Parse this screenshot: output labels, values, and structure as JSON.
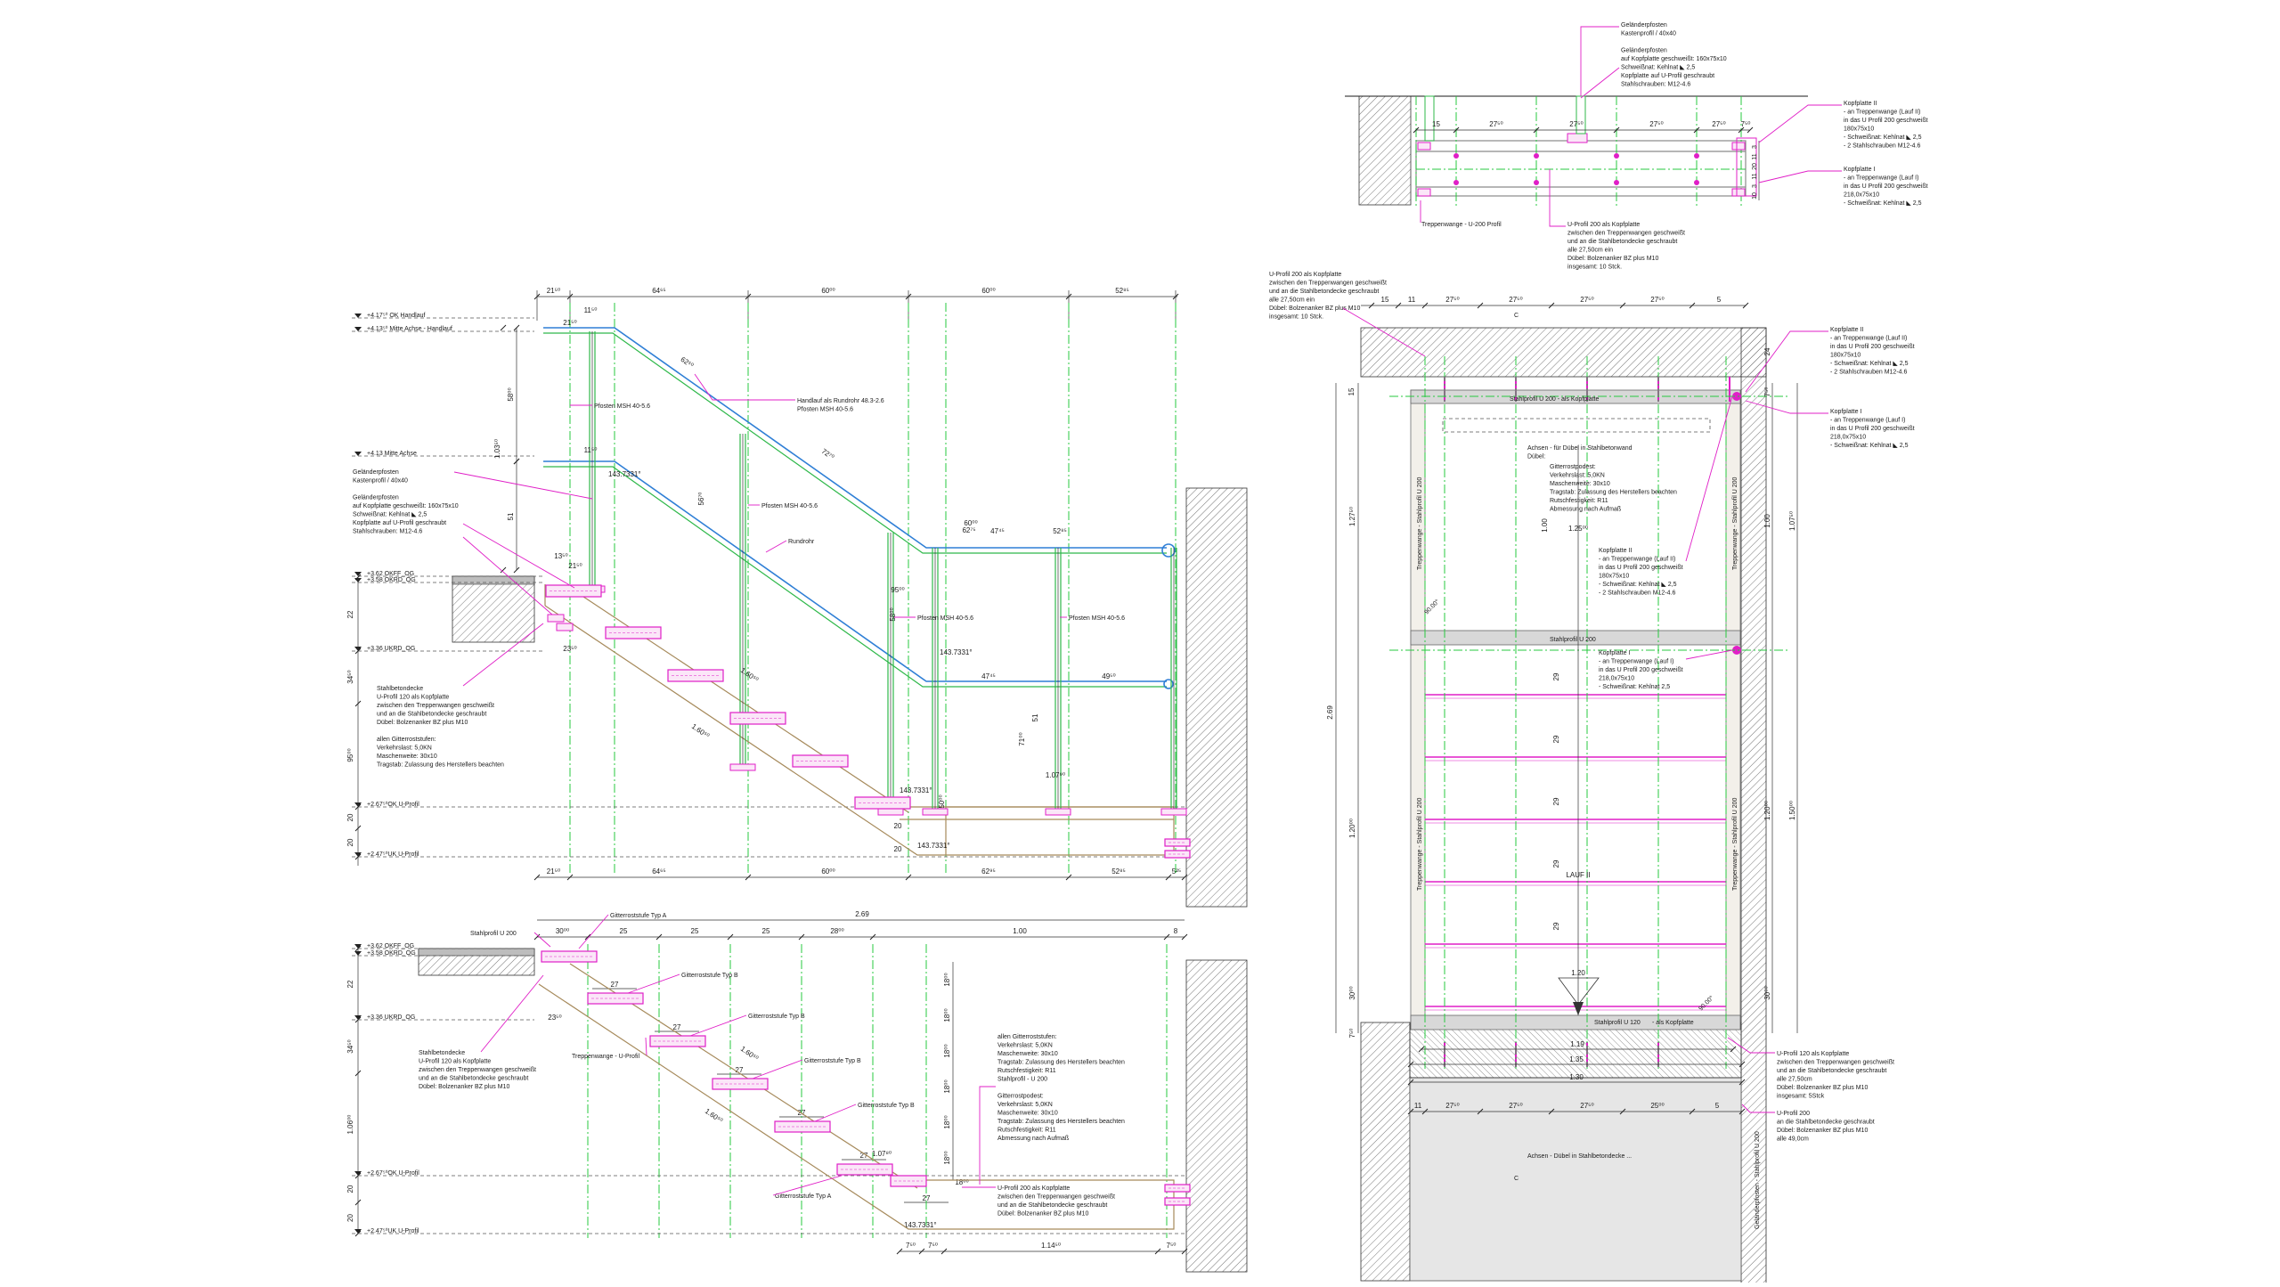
{
  "side_view": {
    "top_dims": [
      "21⁵⁰",
      "64⁶⁵",
      "60⁰⁰",
      "60⁰⁰",
      "52⁸⁵"
    ],
    "bottom_dims": [
      "21⁵⁰",
      "64⁶⁵",
      "60⁰⁰",
      "62⁹⁵",
      "52⁸⁵",
      "5²⁵"
    ],
    "level_labels": [
      "+4.17⁵⁰ OK Handlauf",
      "+4.13⁵⁰ Mitte Achse - Handlauf",
      "+4.13 Mitte Achse",
      "+3.62 OKFF_OG",
      "+3.58 OKRD_OG",
      "+3.36 UKRD_OG",
      "+2.67⁵⁰OK U-Profil",
      "+2.47⁵⁰UK U-Profil"
    ],
    "left_dims": [
      "22",
      "34⁵⁰",
      "95⁰⁰",
      "20",
      "20"
    ],
    "vert_dims": [
      "58⁰⁰",
      "1.03⁵⁰",
      "51"
    ],
    "inline_dims": [
      "11⁵⁰",
      "21⁵⁰",
      "11⁵⁰",
      "13⁵⁰",
      "21⁵⁰",
      "23⁵⁰",
      "62⁵⁰",
      "72⁷⁰",
      "60⁰⁰",
      "62⁷⁵",
      "47⁴⁵",
      "52⁸⁵",
      "95⁰⁰",
      "71⁰⁰",
      "56⁷⁰",
      "1.60⁵⁰",
      "1.60⁵⁰",
      "47⁴⁵",
      "49⁵⁰",
      "1.07⁹⁰",
      "50⁰⁰",
      "58⁰⁰",
      "51",
      "20",
      "20"
    ],
    "angles": [
      "143.7331°",
      "143.7331°",
      "143.7331°",
      "143.7331°"
    ],
    "callouts": {
      "handlauf": [
        "Handlauf als Rundrohr 48.3-2.6",
        "Pfosten MSH 40-5.6"
      ],
      "pfosten1": "Pfosten MSH 40-5.6",
      "pfosten2": "Pfosten MSH 40-5.6",
      "pfosten3": "Pfosten MSH 40-5.6",
      "pfosten4": "Pfosten MSH 40-5.6",
      "rundrohr": "Rundrohr",
      "gelaender": [
        "Geländerpfosten",
        "Kastenprofil / 40x40",
        "",
        "Geländerpfosten",
        "auf Kopfplatte geschweißt: 160x75x10",
        "Schweißnat: Kehlnat ◣ 2,5",
        "Kopfplatte auf U-Profil geschraubt",
        "Stahlschrauben: M12-4.6"
      ],
      "decke": [
        "Stahlbetondecke",
        "U-Profil 120 als Kopfplatte",
        "zwischen den Treppenwangen geschweißt",
        "und an die Stahlbetondecke geschraubt",
        "Dübel: Bolzenanker BZ plus M10",
        "",
        "allen Gitterroststufen:",
        "Verkehrslast: 5,0KN",
        "Maschenweite: 30x10",
        "Tragstab: Zulassung des Herstellers beachten"
      ]
    }
  },
  "section_view": {
    "top_total": "2.69",
    "top_dims": [
      "30⁰⁰",
      "25",
      "25",
      "25",
      "28⁰⁰",
      "1.00",
      "8"
    ],
    "level_labels": [
      "+3.62 OKFF_OG",
      "+3.58 OKRD_OG",
      "+3.36 UKRD_OG",
      "+2.67⁵⁰OK U-Profil",
      "+2.47⁵⁰UK U-Profil"
    ],
    "left_dims": [
      "22",
      "34⁵⁰",
      "1.06⁰⁰",
      "20",
      "20"
    ],
    "right_dims": [
      "18⁰⁰",
      "18⁰⁰",
      "18⁰⁰",
      "18⁰⁰",
      "18⁰⁰",
      "18⁰⁰"
    ],
    "tread_dims": [
      "27",
      "27",
      "27",
      "27",
      "27",
      "27"
    ],
    "inline_dims": [
      "23⁵⁰",
      "1.60⁵⁰",
      "1.60⁵⁰",
      "1.07⁸⁰",
      "20",
      "18⁰⁰"
    ],
    "bottom_dims": [
      "7⁵⁰",
      "7⁵⁰",
      "1.14⁵⁰",
      "7⁵⁰"
    ],
    "angle": "143.7331°",
    "callouts": {
      "stahlprofil": "Stahlprofil U 200",
      "typA_top": "Gitterroststufe Typ A",
      "typB1": "Gitterroststufe Typ B",
      "typB2": "Gitterroststufe Typ B",
      "typB3": "Gitterroststufe Typ B",
      "typB4": "Gitterroststufe Typ B",
      "typA_bot": "Gitterroststufe Typ A",
      "wange": "Treppenwange - U-Profil",
      "decke": [
        "Stahlbetondecke",
        "U-Profil 120 als Kopfplatte",
        "zwischen den Treppenwangen geschweißt",
        "und an die Stahlbetondecke geschraubt",
        "Dübel: Bolzenanker BZ plus M10"
      ],
      "stufen": [
        "allen Gitterroststufen:",
        "Verkehrslast: 5,0KN",
        "Maschenweite: 30x10",
        "Tragstab: Zulassung des Herstellers beachten",
        "Rutschfestigkeit: R11",
        "Stahlprofil - U 200",
        "",
        "Gitterrostpodest:",
        "Verkehrslast: 5,0KN",
        "Maschenweite: 30x10",
        "Tragstab: Zulassung des Herstellers beachten",
        "Rutschfestigkeit: R11",
        "Abmessung nach Aufmaß"
      ],
      "uprofil": [
        "U-Profil 200 als Kopfplatte",
        "zwischen den Treppenwangen geschweißt",
        "und an die Stahlbetondecke geschraubt",
        "Dübel: Bolzenanker BZ plus M10"
      ]
    }
  },
  "top_detail": {
    "dims": [
      "15",
      "27⁵⁰",
      "27⁵⁰",
      "27⁵⁰",
      "27⁵⁰",
      "7⁵⁰"
    ],
    "side_dims": [
      "3",
      "11",
      "20",
      "11",
      "3",
      "10"
    ],
    "callouts": {
      "gelaender": [
        "Geländerpfosten",
        "Kastenprofil / 40x40",
        "",
        "Geländerpfosten",
        "auf Kopfplatte geschweißt: 160x75x10",
        "Schweißnat: Kehlnat ◣ 2,5",
        "Kopfplatte auf U-Profil geschraubt",
        "Stahlschrauben: M12-4.6"
      ],
      "kopf2": [
        "Kopfplatte II",
        "- an Treppenwange (Lauf II)",
        "in das U Profil 200 geschweißt",
        "180x75x10",
        "- Schweißnat: Kehlnat ◣ 2,5",
        "- 2 Stahlschrauben M12-4.6"
      ],
      "kopf1": [
        "Kopfplatte I",
        "- an Treppenwange (Lauf I)",
        "in das U Profil 200 geschweißt",
        "218,0x75x10",
        "- Schweißnat: Kehlnat ◣ 2,5"
      ],
      "wange": "Treppenwange - U-200 Profil",
      "uprofil": [
        "U-Profil 200 als Kopfplatte",
        "zwischen den Treppenwangen geschweißt",
        "und an die Stahlbetondecke geschraubt",
        "alle 27,50cm ein",
        "Dübel: Bolzenanker BZ plus M10",
        "insgesamt: 10 Stck."
      ]
    }
  },
  "plan_view": {
    "top_dims": [
      "15",
      "11",
      "27⁵⁰",
      "27⁵⁰",
      "27⁵⁰",
      "27⁵⁰",
      "5"
    ],
    "bottom_row1": [
      "1.19"
    ],
    "bottom_row2": [
      "1.35"
    ],
    "bottom_row3": [
      "1.30"
    ],
    "bottom_dims": [
      "11",
      "27⁵⁰",
      "27⁵⁰",
      "27⁵⁰",
      "25⁰⁰",
      "5"
    ],
    "left_dims": [
      "15",
      "2.69",
      "1.27⁵⁰",
      "1.20⁰⁰",
      "30⁰⁰",
      "7⁵⁰"
    ],
    "right_dims": [
      "24",
      "7⁵⁰",
      "1.00",
      "1.07⁵⁰",
      "1.20⁰⁰",
      "1.50⁰⁰",
      "30⁰⁰"
    ],
    "inner_dims": [
      "1.00",
      "1.20",
      "1.25⁰⁰",
      "29",
      "29",
      "29",
      "29",
      "29"
    ],
    "angles": [
      "90.00°",
      "90.00°"
    ],
    "labels": {
      "stahl_u200": "Stahlprofil U 200 - als Kopfplatte",
      "stahl_u200b": "Stahlprofil U 200",
      "stahl_u120": "Stahlprofil U 120",
      "als_kopf": "- als Kopfplatte",
      "wange_l": "Treppenwange - Stahlprofil U 200",
      "wange_r": "Treppenwange - Stahlprofil U 200",
      "wange_l2": "Treppenwange - Stahlprofil U 200",
      "wange_r2": "Treppenwange - Stahlprofil U 200",
      "gelaender_r": "Geländerpfosten - Stahlprofil U 200",
      "lauf": "LAUF II",
      "achsen_top": [
        "Achsen - für Dübel in Stahlbetonwand",
        "Dübel:"
      ],
      "achsen_bot": "Achsen - Dübel in Stahlbetondecke ...",
      "podest": [
        "Gitterrostpodest:",
        "Verkehrslast: 5,0KN",
        "Maschenweite: 30x10",
        "Tragstab: Zulassung des Herstellers beachten",
        "Rutschfestigkeit: R11",
        "Abmessung nach Aufmaß"
      ],
      "sec_mark": "C"
    },
    "callouts": {
      "uprofil_top": [
        "U-Profil 200 als Kopfplatte",
        "zwischen den Treppenwangen geschweißt",
        "und an die Stahlbetondecke geschraubt",
        "alle 27,50cm ein",
        "Dübel: Bolzenanker BZ plus M10",
        "insgesamt: 10 Stck."
      ],
      "kopf2_r": [
        "Kopfplatte II",
        "- an Treppenwange (Lauf II)",
        "in das U Profil 200 geschweißt",
        "180x75x10",
        "- Schweißnat: Kehlnat ◣ 2,5",
        "- 2 Stahlschrauben M12-4.6"
      ],
      "kopf1_r": [
        "Kopfplatte I",
        "- an Treppenwange (Lauf I)",
        "in das U Profil 200 geschweißt",
        "218,0x75x10",
        "- Schweißnat: Kehlnat ◣ 2,5"
      ],
      "kopf2_in": [
        "Kopfplatte II",
        "- an Treppenwange (Lauf II)",
        "in das U Profil 200 geschweißt",
        "180x75x10",
        "- Schweißnat: Kehlnat ◣ 2,5",
        "- 2 Stahlschrauben M12-4.6"
      ],
      "kopf1_in": [
        "Kopfplatte I",
        "- an Treppenwange (Lauf I)",
        "in das U Profil 200 geschweißt",
        "218,0x75x10",
        "- Schweißnat: Kehlnat     2,5"
      ],
      "uprofil120": [
        "U-Profil 120 als Kopfplatte",
        "zwischen den Treppenwangen geschweißt",
        "und an die Stahlbetondecke geschraubt",
        "alle 27,50cm",
        "Dübel: Bolzenanker BZ plus M10",
        "insgesamt: 5Stck"
      ],
      "uprofil200": [
        "U-Profil 200",
        "an die Stahlbetondecke geschraubt",
        "Dübel: Bolzenanker BZ plus M10",
        "alle 49,0cm"
      ]
    }
  }
}
